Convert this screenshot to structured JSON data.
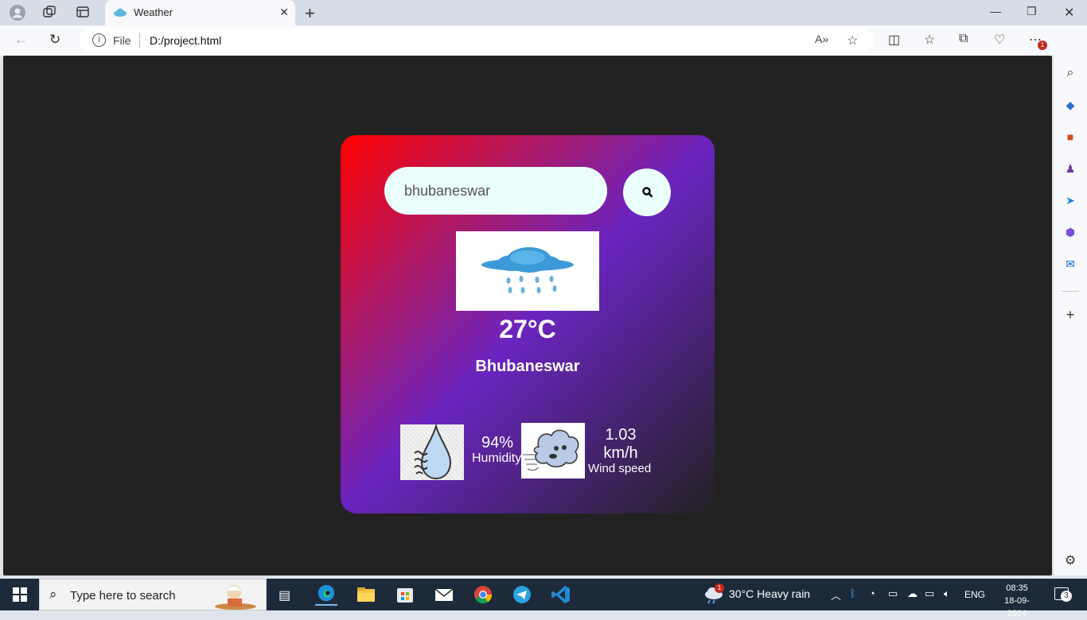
{
  "browser": {
    "tab_title": "Weather",
    "address_prefix": "File",
    "url": "D:/project.html",
    "more_badge": "1"
  },
  "app": {
    "search_value": "bhubaneswar",
    "temperature": "27°C",
    "city": "Bhubaneswar",
    "humidity_value": "94%",
    "humidity_label": "Humidity",
    "wind_value": "1.03 km/h",
    "wind_label": "Wind speed"
  },
  "taskbar": {
    "search_placeholder": "Type here to search",
    "weather_badge": "1",
    "weather_text": "30°C  Heavy rain",
    "language": "ENG",
    "time": "08:35",
    "date": "18-09-2024",
    "notification_count": "3"
  }
}
